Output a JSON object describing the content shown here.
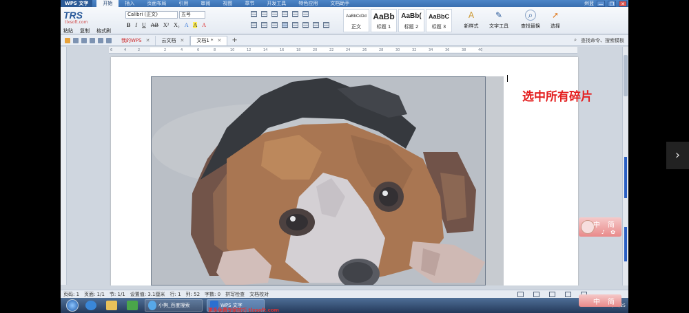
{
  "app": {
    "badge": "WPS 文字",
    "menu_tabs": [
      "开始",
      "插入",
      "页面布局",
      "引用",
      "审阅",
      "视图",
      "章节",
      "开发工具",
      "特色应用",
      "文档助手"
    ],
    "user": "州蓝",
    "window_controls": [
      "—",
      "❐",
      "✕"
    ]
  },
  "ribbon": {
    "logo": "TRS",
    "logo_sub": "tlxsoft.com",
    "paste_label": "粘贴",
    "copy_label": "复制",
    "format_painter_label": "格式刷",
    "font_name": "Calibri (正文)",
    "font_size": "五号",
    "format_buttons": [
      "B",
      "I",
      "U",
      "AB",
      "X²",
      "X₂",
      "A",
      "A",
      "A"
    ],
    "styles": [
      {
        "sample": "AaBbCcDd",
        "name": "正文"
      },
      {
        "sample": "AaBb",
        "name": "标题 1"
      },
      {
        "sample": "AaBb(",
        "name": "标题 2"
      },
      {
        "sample": "AaBbC",
        "name": "标题 3"
      }
    ],
    "new_style_label": "新样式",
    "text_tools_label": "文字工具",
    "find_replace_label": "查找替换",
    "select_label": "选择"
  },
  "tabs": {
    "items": [
      {
        "label": "我的WPS",
        "close": "✕"
      },
      {
        "label": "云文档",
        "close": "✕"
      },
      {
        "label": "文档1 *",
        "close": "✕"
      }
    ],
    "add": "+",
    "search_command": "查找命令、搜索模板"
  },
  "ruler": {
    "ticks": [
      "6",
      "4",
      "2",
      "2",
      "4",
      "6",
      "8",
      "10",
      "12",
      "14",
      "16",
      "18",
      "20",
      "22",
      "24",
      "26",
      "28",
      "30",
      "32",
      "34",
      "36",
      "38",
      "40"
    ]
  },
  "document": {
    "annotation": "选中所有碎片"
  },
  "ime": {
    "chars": "中 简",
    "icons": "♪ ✿"
  },
  "statusbar": {
    "items": [
      "页码: 1",
      "页面: 1/1",
      "节: 1/1",
      "设置值: 3.1厘米",
      "行: 1",
      "列: 52",
      "字数: 0",
      "拼写检查",
      "文档校对"
    ]
  },
  "taskbar": {
    "tasks": [
      {
        "label": "小狗_百度搜索"
      },
      {
        "label": "WPS 文字"
      }
    ],
    "watermark": "更多免费专家技巧 tlxsoft.com",
    "tray_time": "2018/12/25"
  },
  "nav": {
    "next": "›"
  },
  "colors": {
    "accent": "#3a6fb0",
    "annotation": "#e42020"
  }
}
